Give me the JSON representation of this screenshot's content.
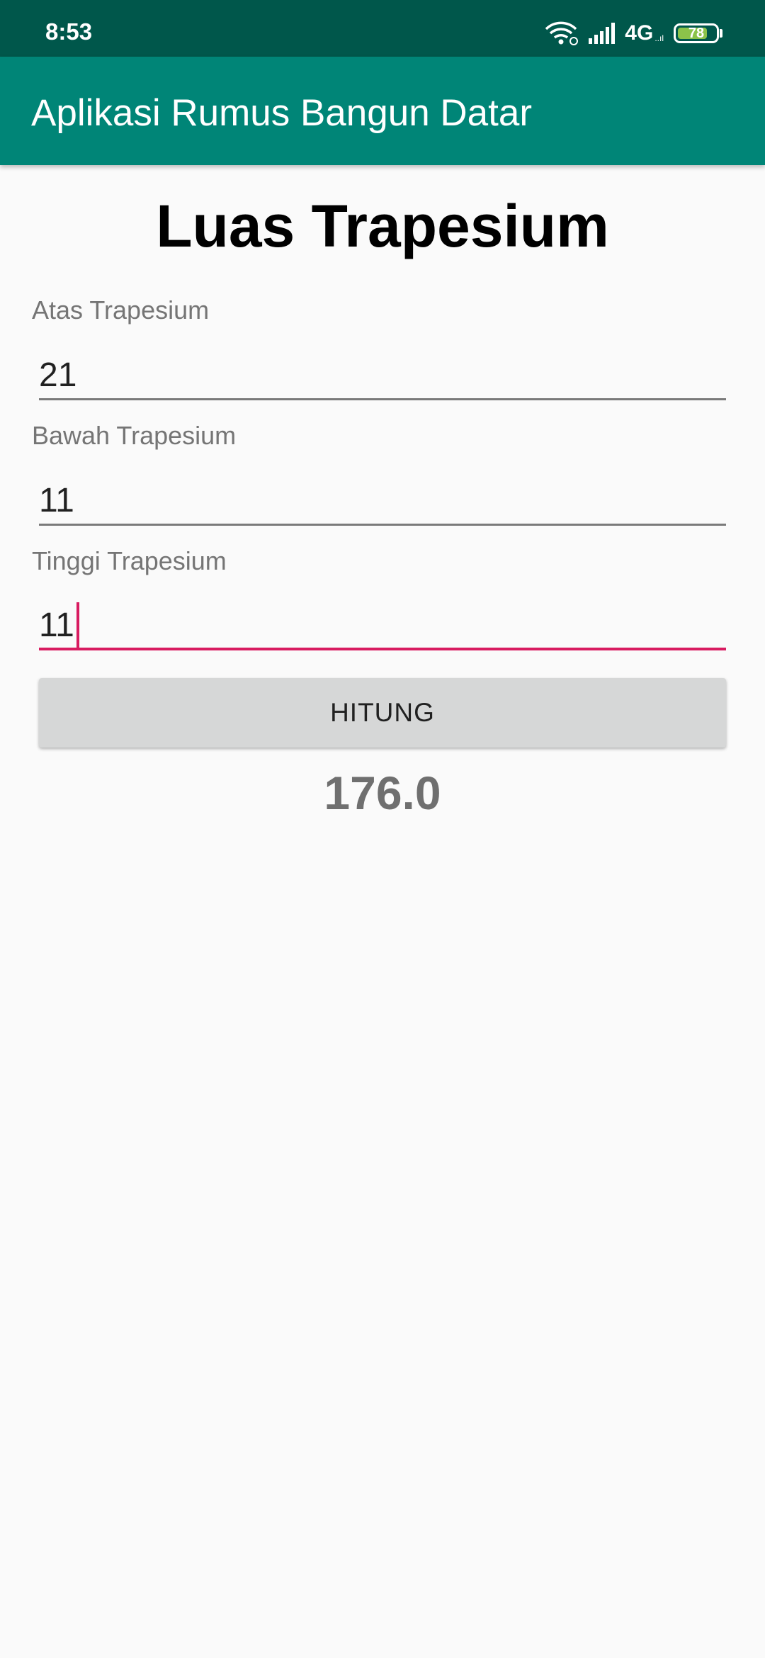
{
  "status_bar": {
    "time": "8:53",
    "network_type": "4G",
    "network_sub": "..ıl",
    "battery_level": "78",
    "battery_fraction": 0.78,
    "icons": [
      "wifi-icon",
      "signal-icon",
      "battery-icon"
    ],
    "background_color": "#00574b"
  },
  "app_bar": {
    "title": "Aplikasi Rumus Bangun Datar",
    "background_color": "#008577"
  },
  "main": {
    "title": "Luas Trapesium",
    "fields": [
      {
        "label": "Atas Trapesium",
        "value": "21"
      },
      {
        "label": "Bawah Trapesium",
        "value": "11"
      },
      {
        "label": "Tinggi Trapesium",
        "value": "11",
        "focused": true
      }
    ],
    "button_label": "HITUNG",
    "result": "176.0",
    "accent_color": "#d81b60"
  }
}
